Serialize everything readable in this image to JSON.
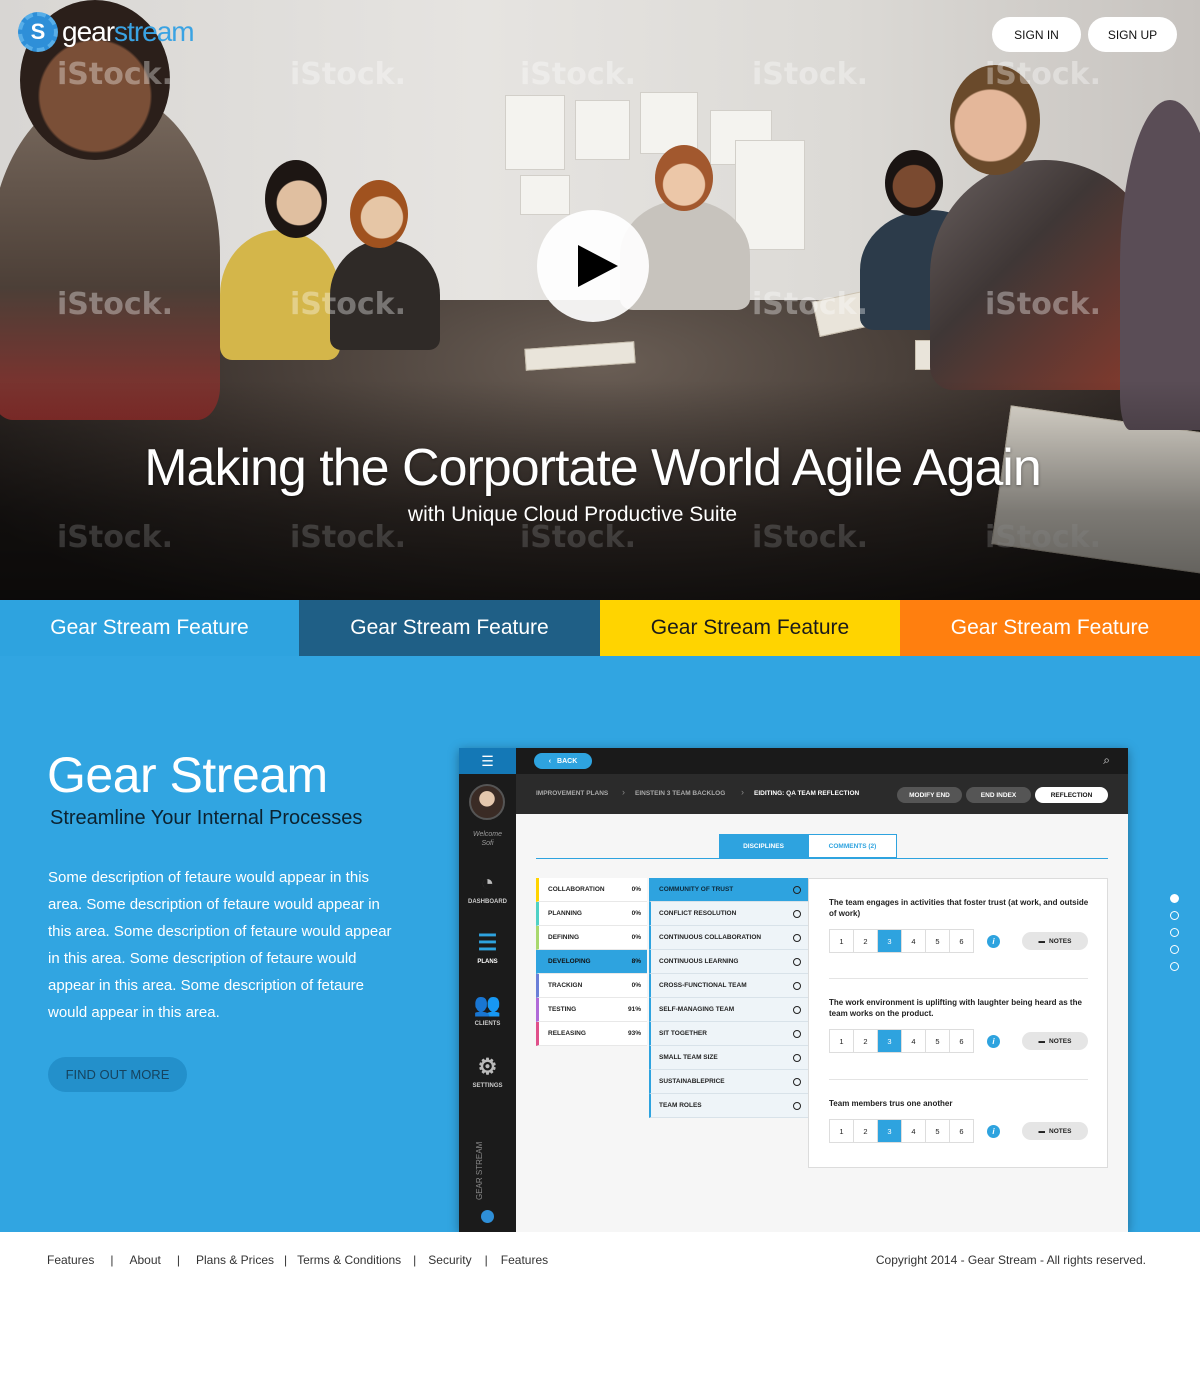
{
  "header": {
    "logo_mark": "S",
    "logo_part1": "gear",
    "logo_part2": "stream",
    "sign_in": "SIGN IN",
    "sign_up": "SIGN UP"
  },
  "hero": {
    "title": "Making the Corportate World Agile Again",
    "subtitle": "with Unique Cloud Productive Suite",
    "watermark": "iStock."
  },
  "feature_tabs": [
    {
      "label": "Gear Stream Feature",
      "color": "#2ea3df"
    },
    {
      "label": "Gear Stream Feature",
      "color": "#1f5f86"
    },
    {
      "label": "Gear Stream Feature",
      "color": "#ffd400"
    },
    {
      "label": "Gear Stream Feature",
      "color": "#ff7f0f"
    }
  ],
  "feature": {
    "title": "Gear Stream",
    "subtitle": "Streamline Your Internal Processes",
    "description": "Some description of fetaure would appear in this area. Some description of fetaure would appear in this area. Some description of fetaure would appear in this area. Some description of fetaure would appear in this area. Some description of fetaure would appear in this area.",
    "cta": "FIND OUT MORE",
    "slide_count": 5,
    "active_slide": 1
  },
  "app": {
    "back": "BACK",
    "welcome": "Welcome",
    "user": "Sofi",
    "nav": [
      {
        "label": "DASHBOARD",
        "icon": "dashboard-icon",
        "active": false
      },
      {
        "label": "PLANS",
        "icon": "plans-icon",
        "active": true
      },
      {
        "label": "CLIENTS",
        "icon": "clients-icon",
        "active": false
      },
      {
        "label": "SETTINGS",
        "icon": "gear-icon",
        "active": false
      }
    ],
    "brand": "GEAR STREAM",
    "breadcrumb": [
      "IMPROVEMENT PLANS",
      "EINSTEIN 3 TEAM BACKLOG",
      "EIDITING: QA TEAM REFLECTION"
    ],
    "actions": [
      "MODIFY END",
      "END INDEX",
      "REFLECTION"
    ],
    "subtabs": [
      "DISCIPLINES",
      "COMMENTS (2)"
    ],
    "disciplines": [
      {
        "name": "COLLABORATION",
        "pct": "0%",
        "color": "#ffd400"
      },
      {
        "name": "PLANNING",
        "pct": "0%",
        "color": "#4fd1c5"
      },
      {
        "name": "DEFINING",
        "pct": "0%",
        "color": "#a8d86e"
      },
      {
        "name": "DEVELOPING",
        "pct": "8%",
        "color": "#2ea3df"
      },
      {
        "name": "TRACKIGN",
        "pct": "0%",
        "color": "#6a7fd8"
      },
      {
        "name": "TESTING",
        "pct": "91%",
        "color": "#b06ad8"
      },
      {
        "name": "RELEASING",
        "pct": "93%",
        "color": "#e0508a"
      }
    ],
    "practices": [
      "COMMUNITY OF TRUST",
      "CONFLICT RESOLUTION",
      "CONTINUOUS COLLABORATION",
      "CONTINUOUS LEARNING",
      "CROSS-FUNCTIONAL TEAM",
      "SELF-MANAGING TEAM",
      "SIT TOGETHER",
      "SMALL TEAM SIZE",
      "SUSTAINABLEPRICE",
      "TEAM ROLES"
    ],
    "questions": [
      {
        "text": "The team engages in activities that foster trust (at work, and outside of work)",
        "selected": 3
      },
      {
        "text": "The work environment is uplifting with laughter being heard as the team works on the product.",
        "selected": 3
      },
      {
        "text": "Team members trus one another",
        "selected": 3
      }
    ],
    "scale": [
      "1",
      "2",
      "3",
      "4",
      "5",
      "6"
    ],
    "info": "i",
    "notes": "NOTES"
  },
  "footer": {
    "links": [
      "Features",
      "About",
      "Plans & Prices",
      "Terms & Conditions",
      "Security",
      "Features"
    ],
    "separator": "|",
    "copyright": "Copyright 2014 - Gear Stream - All rights reserved."
  }
}
